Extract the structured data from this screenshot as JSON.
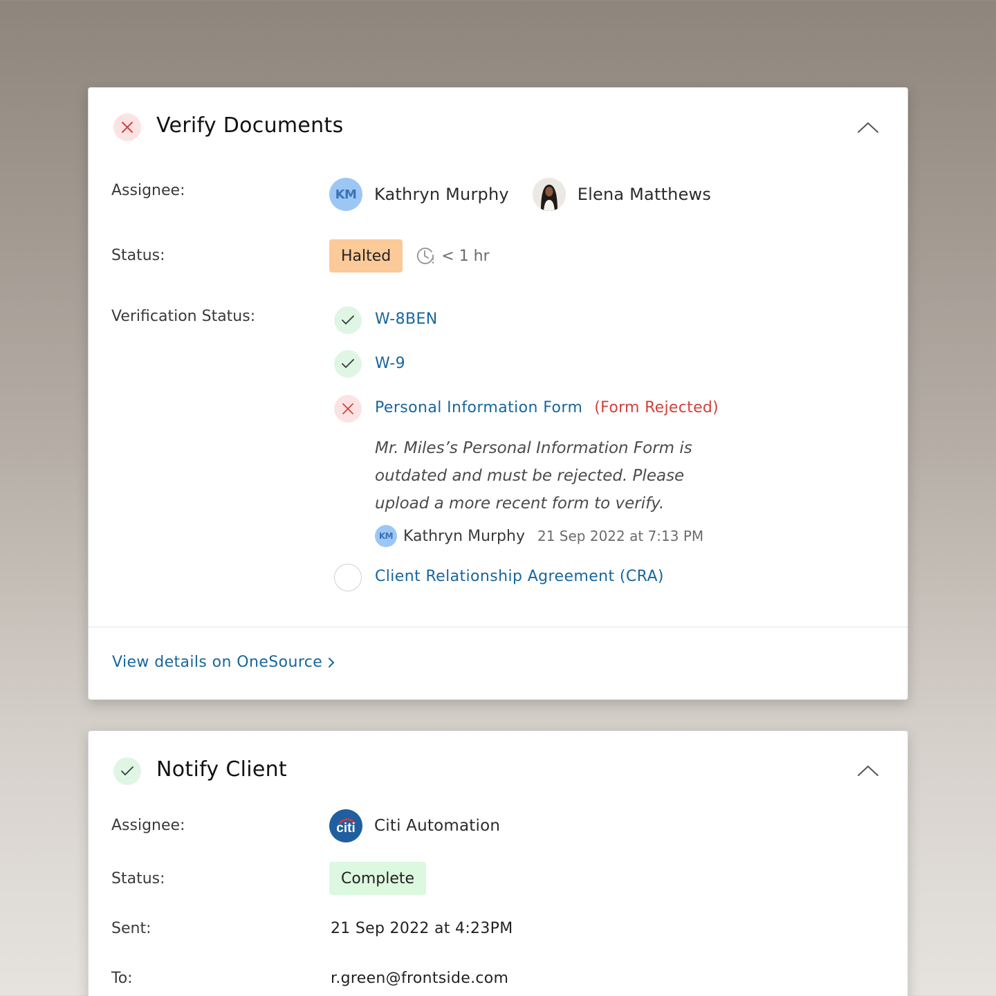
{
  "verify_card": {
    "title": "Verify Documents",
    "assignee_label": "Assignee:",
    "assignees": [
      {
        "initials": "KM",
        "name": "Kathryn Murphy"
      },
      {
        "name": "Elena Matthews"
      }
    ],
    "status_label": "Status:",
    "status_value": "Halted",
    "time_elapsed": "< 1 hr",
    "verification_label": "Verification Status:",
    "documents": [
      {
        "name": "W-8BEN",
        "state": "verified"
      },
      {
        "name": "W-9",
        "state": "verified"
      },
      {
        "name": "Personal Information Form",
        "state": "rejected",
        "note": "(Form Rejected)"
      },
      {
        "name": "Client Relationship Agreement (CRA)",
        "state": "pending"
      }
    ],
    "comment": {
      "text": "Mr. Miles’s Personal Information Form is outdated and must be rejected. Please upload a more recent form to verify.",
      "author_initials": "KM",
      "author": "Kathryn Murphy",
      "date": "21 Sep 2022 at 7:13 PM"
    },
    "footer_link": "View details on OneSource"
  },
  "notify_card": {
    "title": "Notify Client",
    "assignee_label": "Assignee:",
    "assignee": {
      "logo_text": "citi",
      "name": "Citi Automation"
    },
    "status_label": "Status:",
    "status_value": "Complete",
    "sent_label": "Sent:",
    "sent_value": "21 Sep 2022 at 4:23PM",
    "to_label": "To:",
    "to_value": "r.green@frontside.com"
  },
  "colors": {
    "link": "#17669c",
    "rejected": "#d2403a",
    "halted_bg": "#fcc998",
    "complete_bg": "#dcf8df"
  }
}
